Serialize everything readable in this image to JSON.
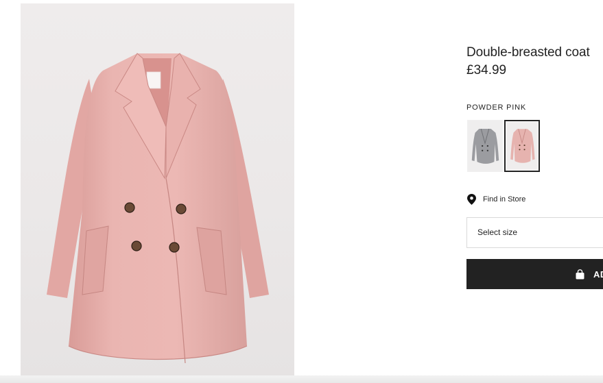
{
  "product": {
    "title": "Double-breasted coat",
    "price": "£34.99",
    "image_alt": "pink-coat-product-image"
  },
  "color": {
    "selected_label": "POWDER PINK",
    "swatches": [
      {
        "name": "grey",
        "color": "#9a9a9e",
        "selected": false
      },
      {
        "name": "powder-pink",
        "color": "#e3b1ae",
        "selected": true
      }
    ]
  },
  "store": {
    "find_label": "Find in Store",
    "icon": "map-pin-icon"
  },
  "size": {
    "placeholder": "Select size"
  },
  "cart": {
    "add_label": "AD",
    "icon": "shopping-bag-icon"
  },
  "colors": {
    "button_bg": "#222222",
    "coat_pink": "#e8b4b0",
    "image_bg": "#ece9e9"
  }
}
